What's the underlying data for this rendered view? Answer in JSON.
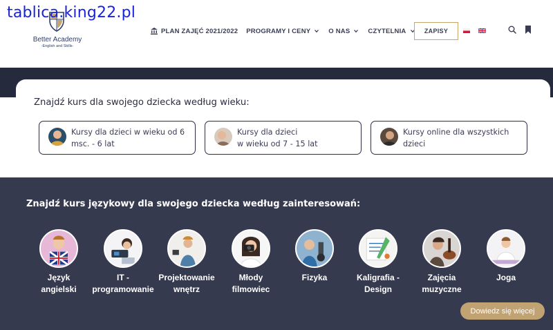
{
  "watermark": "tablica.king22.pl",
  "logo": {
    "name": "Better Academy",
    "tagline": "-English and Skills-"
  },
  "nav": {
    "plan": "PLAN ZAJĘĆ 2021/2022",
    "programy": "PROGRAMY I CENY",
    "onas": "O NAS",
    "czytelnia": "CZYTELNIA",
    "zapisy": "ZAPISY"
  },
  "icons": {
    "plan": "bank-icon",
    "dropdown": "chevron-down-icon",
    "lang_pl": "flag-pl-icon",
    "lang_en": "flag-en-icon",
    "search": "search-icon",
    "bookmark": "bookmark-icon"
  },
  "age_section": {
    "title": "Znajdź kurs dla swojego dziecka według wieku:",
    "options": [
      {
        "label": "Kursy dla dzieci w wieku od 6\nmsc. - 6 lat"
      },
      {
        "label": "Kursy dla dzieci\nw wieku od 7 - 15 lat"
      },
      {
        "label": "Kursy online dla wszystkich\ndzieci"
      }
    ]
  },
  "interests_section": {
    "title": "Znajdź kurs językowy dla swojego dziecka według zainteresowań:",
    "items": [
      {
        "label": "Język\nangielski"
      },
      {
        "label": "IT -\nprogramowanie"
      },
      {
        "label": "Projektowanie\nwnętrz"
      },
      {
        "label": "Młody\nfilmowiec"
      },
      {
        "label": "Fizyka"
      },
      {
        "label": "Kaligrafia -\nDesign"
      },
      {
        "label": "Zajęcia\nmuzyczne"
      },
      {
        "label": "Joga"
      }
    ]
  },
  "cta": {
    "label": "Dowiedz się więcej"
  },
  "colors": {
    "navy_dark": "#262a3d",
    "navy": "#363a4f",
    "gold": "#c1a373",
    "watermark_blue": "#1a24d6"
  }
}
